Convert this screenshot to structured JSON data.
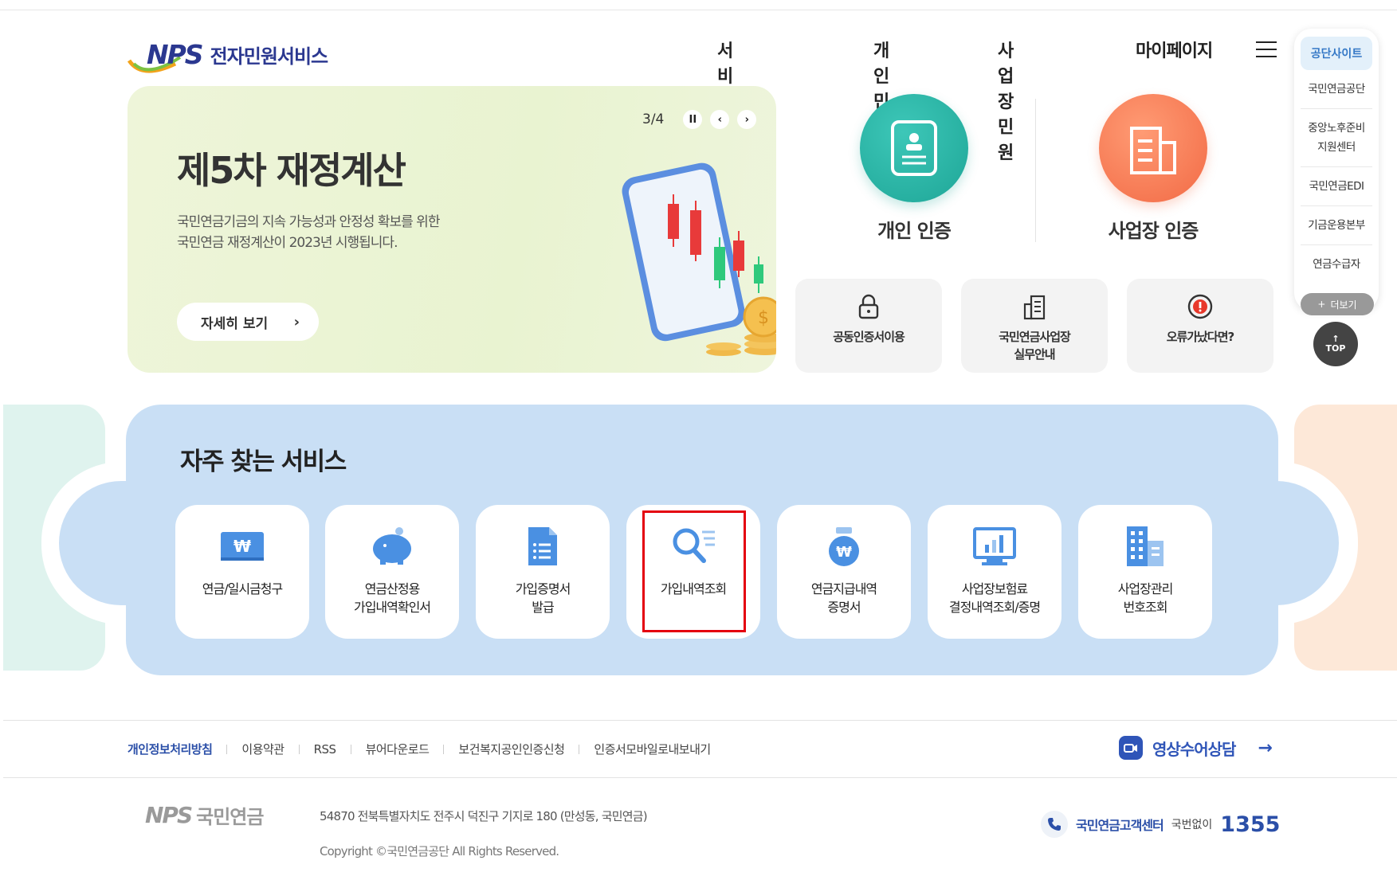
{
  "header": {
    "logo_text": "NPS",
    "site_title": "전자민원서비스",
    "nav": [
      "서비스가이드",
      "개인민원",
      "사업장민원",
      "마이페이지"
    ]
  },
  "banner": {
    "title": "제5차 재정계산",
    "desc_line1": "국민연금기금의 지속 가능성과 안정성 확보를 위한",
    "desc_line2": "국민연금 재정계산이 2023년 시행됩니다.",
    "detail_button": "자세히 보기",
    "page_indicator": "3/4"
  },
  "certification": {
    "personal_label": "개인 인증",
    "business_label": "사업장 인증"
  },
  "quick_boxes": [
    {
      "label": "공동인증서이용"
    },
    {
      "label_line1": "국민연금사업장",
      "label_line2": "실무안내"
    },
    {
      "label": "오류가났다면?"
    }
  ],
  "side_menu": {
    "top": "공단사이트",
    "items": [
      "국민연금공단",
      "중앙노후준비",
      "지원센터",
      "국민연금EDI",
      "기금운용본부",
      "연금수급자"
    ],
    "more": "더보기",
    "top_button": "TOP"
  },
  "frequent": {
    "title": "자주 찾는 서비스",
    "cards": [
      {
        "line1": "연금/일시금청구",
        "line2": "",
        "icon": "won-card-icon"
      },
      {
        "line1": "연금산정용",
        "line2": "가입내역확인서",
        "icon": "piggy-bank-icon"
      },
      {
        "line1": "가입증명서",
        "line2": "발급",
        "icon": "document-icon"
      },
      {
        "line1": "가입내역조회",
        "line2": "",
        "icon": "search-list-icon"
      },
      {
        "line1": "연금지급내역",
        "line2": "증명서",
        "icon": "money-bag-icon"
      },
      {
        "line1": "사업장보험료",
        "line2": "결정내역조회/증명",
        "icon": "monitor-chart-icon"
      },
      {
        "line1": "사업장관리",
        "line2": "번호조회",
        "icon": "building-icon"
      }
    ]
  },
  "footer": {
    "links": [
      "개인정보처리방침",
      "이용약관",
      "RSS",
      "뷰어다운로드",
      "보건복지공인인증신청",
      "인증서모바일로내보내기"
    ],
    "video_consult": "영상수어상담",
    "logo_nps": "NPS",
    "logo_name": "국민연금",
    "address": "54870 전북특별자치도 전주시 덕진구 기지로 180 (만성동, 국민연금)",
    "copyright": "Copyright ©국민연금공단 All Rights Reserved.",
    "callcenter_name": "국민연금고객센터",
    "callcenter_sub": "국번없이",
    "callcenter_number": "1355"
  }
}
